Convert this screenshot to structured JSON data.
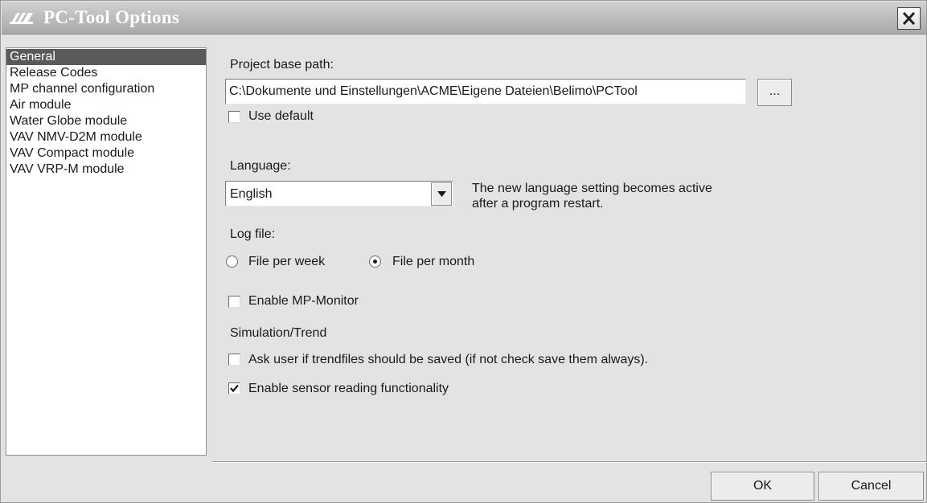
{
  "window": {
    "title": "PC-Tool Options"
  },
  "icons": {
    "app": "belimo-logo-icon",
    "close": "close-icon",
    "dropdown": "chevron-down-icon",
    "check": "checkmark-icon"
  },
  "nav": {
    "items": [
      "General",
      "Release Codes",
      "MP channel configuration",
      "Air module",
      "Water Globe module",
      "VAV NMV-D2M module",
      "VAV Compact module",
      "VAV VRP-M module"
    ],
    "selected": "General"
  },
  "general": {
    "project_base_path_label": "Project base path:",
    "project_base_path_value": "C:\\Dokumente und Einstellungen\\ACME\\Eigene Dateien\\Belimo\\PCTool",
    "browse_label": "...",
    "use_default_label": "Use default",
    "use_default_checked": false,
    "language_label": "Language:",
    "language_value": "English",
    "language_note_line1": "The new language setting becomes active",
    "language_note_line2": "after a program restart.",
    "log_file_label": "Log file:",
    "log_file_per_week_label": "File per week",
    "log_file_per_month_label": "File per month",
    "log_file_selected": "File per month",
    "enable_mp_monitor_label": "Enable MP-Monitor",
    "enable_mp_monitor_checked": false,
    "simulation_trend_label": "Simulation/Trend",
    "ask_user_trendfiles_label": "Ask user if trendfiles should be saved (if not check save them always).",
    "ask_user_trendfiles_checked": false,
    "enable_sensor_reading_label": "Enable sensor reading functionality",
    "enable_sensor_reading_checked": true
  },
  "footer": {
    "ok_label": "OK",
    "cancel_label": "Cancel"
  }
}
